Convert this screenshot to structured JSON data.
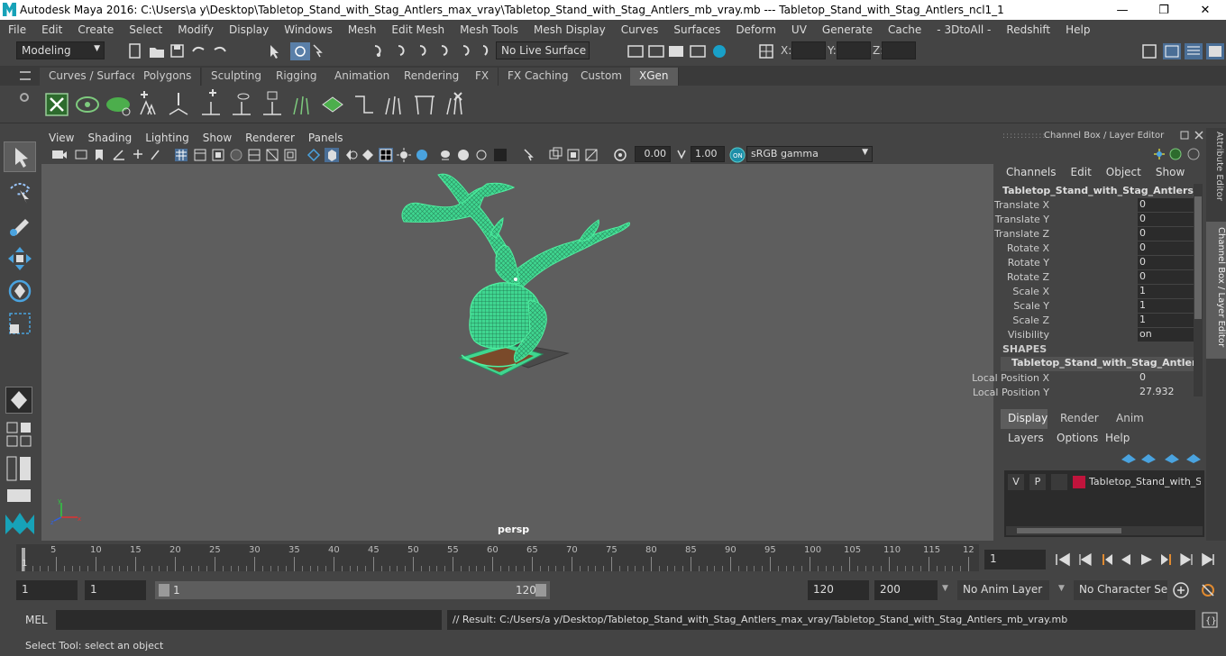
{
  "window": {
    "title": "Autodesk Maya 2016: C:\\Users\\a y\\Desktop\\Tabletop_Stand_with_Stag_Antlers_max_vray\\Tabletop_Stand_with_Stag_Antlers_mb_vray.mb   ---   Tabletop_Stand_with_Stag_Antlers_ncl1_1",
    "minimize": "—",
    "maximize": "❐",
    "close": "✕"
  },
  "menu": [
    "File",
    "Edit",
    "Create",
    "Select",
    "Modify",
    "Display",
    "Windows",
    "Mesh",
    "Edit Mesh",
    "Mesh Tools",
    "Mesh Display",
    "Curves",
    "Surfaces",
    "Deform",
    "UV",
    "Generate",
    "Cache",
    "- 3DtoAll -",
    "Redshift",
    "Help"
  ],
  "status": {
    "mode": "Modeling",
    "live_surface": "No Live Surface",
    "x_label": "X:",
    "y_label": "Y:",
    "z_label": "Z:"
  },
  "shelf_tabs": [
    "Curves / Surfaces",
    "Polygons",
    "Sculpting",
    "Rigging",
    "Animation",
    "Rendering",
    "FX",
    "FX Caching",
    "Custom",
    "XGen"
  ],
  "active_shelf_tab": "XGen",
  "viewport": {
    "menu": [
      "View",
      "Shading",
      "Lighting",
      "Show",
      "Renderer",
      "Panels"
    ],
    "exposure": "0.00",
    "gamma": "1.00",
    "color_space": "sRGB gamma",
    "camera_label": "persp",
    "colors": {
      "wire": "#4ff0a0",
      "bg": "#5e5e5e",
      "stand": "#7a4a2a"
    }
  },
  "channel_box": {
    "header": "Channel Box / Layer Editor",
    "menu": [
      "Channels",
      "Edit",
      "Object",
      "Show"
    ],
    "object_name": "Tabletop_Stand_with_Stag_Antlers_ncl...",
    "attrs": [
      {
        "label": "Translate X",
        "value": "0"
      },
      {
        "label": "Translate Y",
        "value": "0"
      },
      {
        "label": "Translate Z",
        "value": "0"
      },
      {
        "label": "Rotate X",
        "value": "0"
      },
      {
        "label": "Rotate Y",
        "value": "0"
      },
      {
        "label": "Rotate Z",
        "value": "0"
      },
      {
        "label": "Scale X",
        "value": "1"
      },
      {
        "label": "Scale Y",
        "value": "1"
      },
      {
        "label": "Scale Z",
        "value": "1"
      },
      {
        "label": "Visibility",
        "value": "on"
      }
    ],
    "shapes_header": "SHAPES",
    "shape_name": "Tabletop_Stand_with_Stag_Antlers_...",
    "shape_attrs": [
      {
        "label": "Local Position X",
        "value": "0"
      },
      {
        "label": "Local Position Y",
        "value": "27.932"
      }
    ]
  },
  "layer_editor": {
    "tabs": [
      "Display",
      "Render",
      "Anim"
    ],
    "active_tab": "Display",
    "menu": [
      "Layers",
      "Options",
      "Help"
    ],
    "layer": {
      "v": "V",
      "p": "P",
      "name": "Tabletop_Stand_with_Stag_Antlers",
      "color": "#c0143c"
    }
  },
  "side_tabs": [
    "Attribute Editor",
    "Channel Box / Layer Editor"
  ],
  "timeline": {
    "ticks": [
      "5",
      "10",
      "15",
      "20",
      "25",
      "30",
      "35",
      "40",
      "45",
      "50",
      "55",
      "60",
      "65",
      "70",
      "75",
      "80",
      "85",
      "90",
      "95",
      "100",
      "105",
      "110",
      "115",
      "12"
    ],
    "start_label": "1",
    "current_frame": "1"
  },
  "range": {
    "start": "1",
    "inner_start": "1",
    "slider_start": "1",
    "slider_end": "120",
    "end": "120",
    "outer_end": "200",
    "anim_layer": "No Anim Layer",
    "character_set": "No Character Set"
  },
  "command": {
    "label": "MEL",
    "result": "// Result: C:/Users/a y/Desktop/Tabletop_Stand_with_Stag_Antlers_max_vray/Tabletop_Stand_with_Stag_Antlers_mb_vray.mb"
  },
  "help_line": "Select Tool: select an object"
}
